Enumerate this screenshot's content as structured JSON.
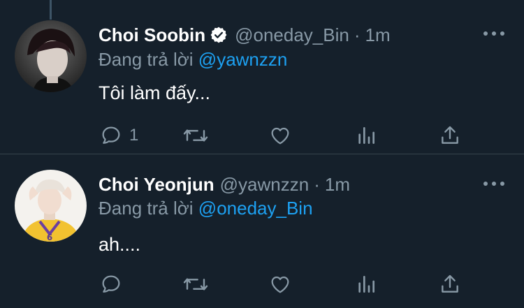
{
  "tweets": [
    {
      "author": {
        "name": "Choi Soobin",
        "verified": true,
        "handle": "@oneday_Bin"
      },
      "separator": "·",
      "time": "1m",
      "reply_prefix": "Đang trả lời",
      "reply_to": "@yawnzzn",
      "text": "Tôi làm đấy...",
      "actions": {
        "reply_count": "1"
      }
    },
    {
      "author": {
        "name": "Choi Yeonjun",
        "verified": false,
        "handle": "@yawnzzn"
      },
      "separator": "·",
      "time": "1m",
      "reply_prefix": "Đang trả lời",
      "reply_to": "@oneday_Bin",
      "text": "ah....",
      "actions": {
        "reply_count": ""
      }
    }
  ],
  "colors": {
    "background": "#15202b",
    "text_primary": "#ffffff",
    "text_secondary": "#8899a6",
    "accent": "#1da1f2",
    "divider": "#38444d"
  },
  "icons": [
    "verified-badge-icon",
    "more-icon",
    "reply-icon",
    "retweet-icon",
    "like-icon",
    "analytics-icon",
    "share-icon"
  ]
}
